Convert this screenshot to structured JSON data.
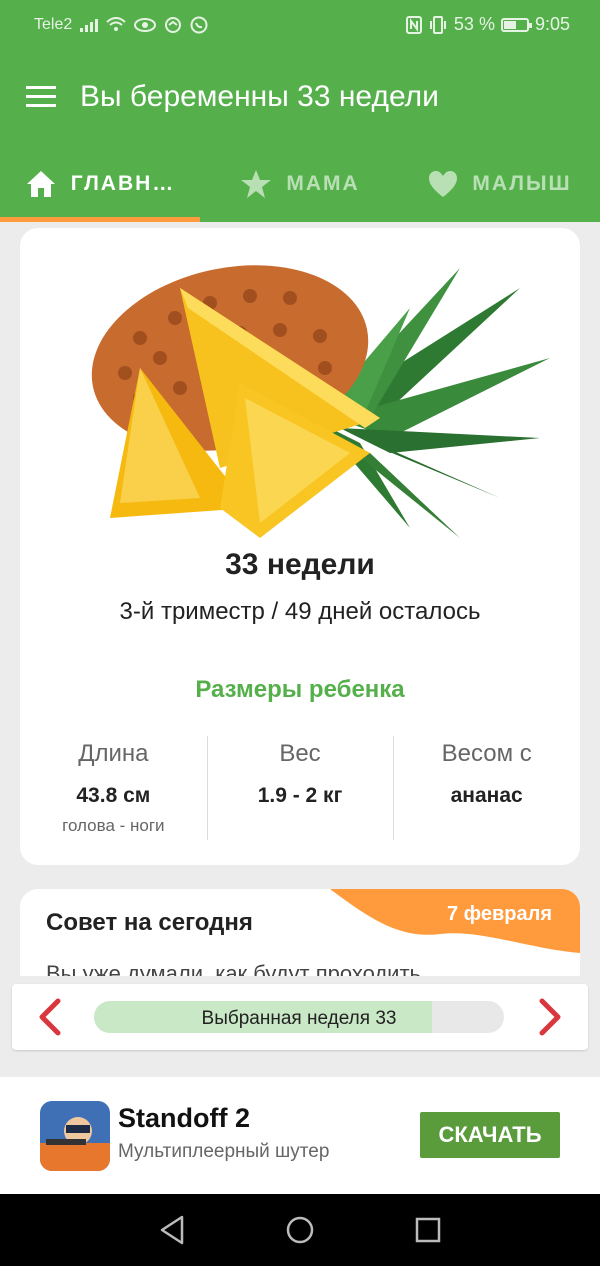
{
  "status_bar": {
    "carrier": "Tele2",
    "battery_percent": "53 %",
    "battery_level": 0.53,
    "time": "9:05"
  },
  "app_bar": {
    "title": "Вы беременны 33 недели"
  },
  "tabs": [
    {
      "label": "ГЛАВН…",
      "icon": "home-icon",
      "active": true
    },
    {
      "label": "МАМА",
      "icon": "star-icon",
      "active": false
    },
    {
      "label": "МАЛЫШ",
      "icon": "heart-icon",
      "active": false
    }
  ],
  "main_card": {
    "week_title": "33 недели",
    "trimester_info": "3-й триместр / 49 дней осталось",
    "sizes_title": "Размеры ребенка",
    "stats": [
      {
        "label": "Длина",
        "value": "43.8 см",
        "sub": "голова - ноги"
      },
      {
        "label": "Вес",
        "value": "1.9 - 2 кг",
        "sub": ""
      },
      {
        "label": "Весом с",
        "value": "ананас",
        "sub": ""
      }
    ]
  },
  "tip_card": {
    "title": "Совет на сегодня",
    "date": "7 февраля",
    "preview": "Вы уже думали, как будут проходить"
  },
  "week_nav": {
    "label": "Выбранная неделя 33",
    "progress": 0.825
  },
  "ad": {
    "app_name": "Standoff 2",
    "description": "Мультиплеерный шутер",
    "cta": "СКАЧАТЬ"
  },
  "colors": {
    "primary": "#55b04c",
    "accent": "#ff9b3d",
    "arrow": "#d9363e",
    "ad_button": "#5a9b3c"
  }
}
